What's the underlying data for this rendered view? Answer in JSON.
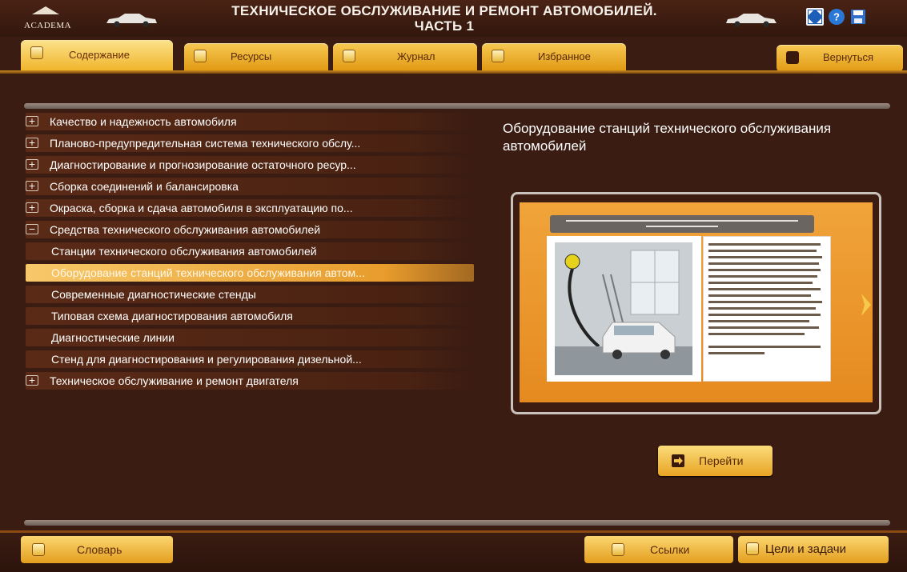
{
  "header": {
    "logo_text": "ACADEMA",
    "title_line1": "ТЕХНИЧЕСКОЕ ОБСЛУЖИВАНИЕ И РЕМОНТ АВТОМОБИЛЕЙ.",
    "title_line2": "ЧАСТЬ 1",
    "icons": [
      "fullscreen-icon",
      "help-icon",
      "save-icon"
    ]
  },
  "tabs": [
    {
      "label": "Содержание",
      "icon": "contents-icon",
      "active": true
    },
    {
      "label": "Ресурсы",
      "icon": "bar-chart-icon",
      "active": false
    },
    {
      "label": "Журнал",
      "icon": "journal-icon",
      "active": false
    },
    {
      "label": "Избранное",
      "icon": "star-icon",
      "active": false
    }
  ],
  "return_button": {
    "label": "Вернуться",
    "icon": "arrow-left-icon"
  },
  "toc": [
    {
      "label": "Качество и надежность автомобиля",
      "toggle": "+",
      "level": 0
    },
    {
      "label": "Планово-предупредительная система технического обслу...",
      "toggle": "+",
      "level": 0
    },
    {
      "label": "Диагностирование и прогнозирование остаточного ресур...",
      "toggle": "+",
      "level": 0
    },
    {
      "label": "Сборка соединений и балансировка",
      "toggle": "+",
      "level": 0
    },
    {
      "label": "Окраска, сборка и сдача автомобиля в эксплуатацию по...",
      "toggle": "+",
      "level": 0
    },
    {
      "label": "Средства технического обслуживания автомобилей",
      "toggle": "−",
      "level": 0
    },
    {
      "label": "Станции технического обслуживания автомобилей",
      "level": 1
    },
    {
      "label": "Оборудование станций технического обслуживания автом...",
      "level": 1,
      "selected": true
    },
    {
      "label": "Современные диагностические стенды",
      "level": 1
    },
    {
      "label": "Типовая схема диагностирования автомобиля",
      "level": 1
    },
    {
      "label": "Диагностические линии",
      "level": 1
    },
    {
      "label": "Стенд для диагностирования и регулирования дизельной...",
      "level": 1
    },
    {
      "label": "Техническое обслуживание и ремонт двигателя",
      "toggle": "+",
      "level": 0
    }
  ],
  "preview": {
    "title": "Оборудование станций технического обслуживания автомобилей",
    "next_icon": "chevron-right-icon"
  },
  "go_button": {
    "label": "Перейти",
    "icon": "arrow-right-icon"
  },
  "footer": {
    "glossary_label": "Словарь",
    "links_label": "Ссылки",
    "goals_label": "Цели и задачи"
  },
  "colors": {
    "background": "#3a1c12",
    "accent": "#f0b52c",
    "selected_row": "#e89c2c"
  }
}
